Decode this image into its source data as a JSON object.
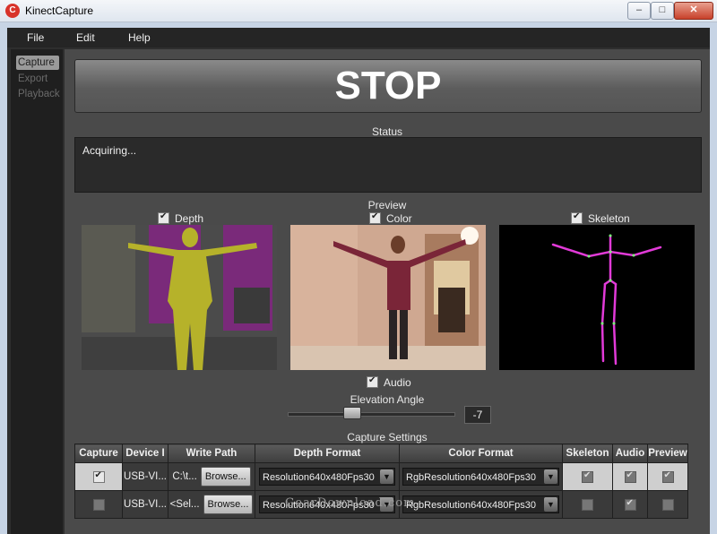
{
  "window": {
    "title": "KinectCapture",
    "icon_glyph": "C",
    "min_glyph": "–",
    "max_glyph": "□",
    "close_glyph": "✕"
  },
  "menu": [
    "File",
    "Edit",
    "Help"
  ],
  "nav": [
    {
      "label": "Capture",
      "active": true
    },
    {
      "label": "Export",
      "active": false
    },
    {
      "label": "Playback",
      "active": false
    }
  ],
  "stop_button": {
    "label": "STOP"
  },
  "status": {
    "label": "Status",
    "text": "Acquiring..."
  },
  "preview": {
    "label": "Preview",
    "depth": {
      "label": "Depth",
      "checked": true
    },
    "color": {
      "label": "Color",
      "checked": true
    },
    "skeleton": {
      "label": "Skeleton",
      "checked": true
    }
  },
  "audio": {
    "label": "Audio",
    "checked": true
  },
  "elevation": {
    "label": "Elevation Angle",
    "value": "-7",
    "min": -27,
    "max": 27
  },
  "capture_settings": {
    "label": "Capture Settings",
    "columns": [
      "Capture",
      "Device I",
      "Write Path",
      "Depth Format",
      "Color Format",
      "Skeleton",
      "Audio",
      "Preview"
    ],
    "browse_label": "Browse...",
    "rows": [
      {
        "capture": true,
        "device": "USB-VI...",
        "path": "C:\\t...",
        "depth_format": "Resolution640x480Fps30",
        "color_format": "RgbResolution640x480Fps30",
        "skeleton": true,
        "audio": true,
        "preview": true
      },
      {
        "capture": false,
        "device": "USB-VI...",
        "path": "<Sel...",
        "depth_format": "Resolution640x480Fps30",
        "color_format": "RgbResolution640x480Fps30",
        "skeleton": false,
        "audio": true,
        "preview": false
      }
    ]
  },
  "watermark": "GearDownload.com",
  "colors": {
    "depth_body": "#b6b22a",
    "depth_bg": "#7a2a7a",
    "skeleton_line": "#e23ad8"
  }
}
